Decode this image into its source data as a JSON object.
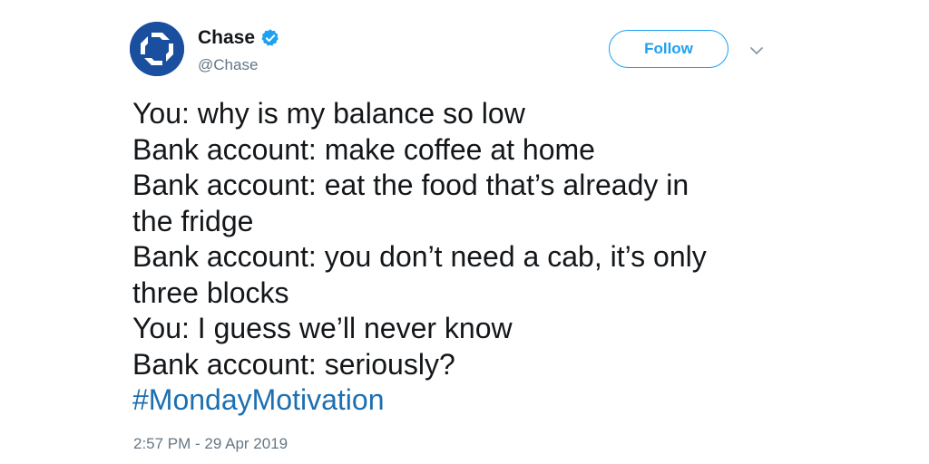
{
  "account": {
    "display_name": "Chase",
    "handle": "@Chase",
    "verified_icon": "verified-badge-icon",
    "avatar_icon": "chase-octagon-logo"
  },
  "header": {
    "follow_label": "Follow",
    "menu_icon": "chevron-down-icon"
  },
  "tweet": {
    "lines": [
      "You: why is my balance so low",
      "Bank account: make coffee at home",
      "Bank account: eat the food that’s already in",
      "the fridge",
      "Bank account: you don’t need a cab, it’s only",
      "three blocks",
      "You: I guess we’ll never know",
      "Bank account: seriously?"
    ],
    "hashtag": "#MondayMotivation",
    "timestamp": "2:57 PM - 29 Apr 2019"
  },
  "colors": {
    "brand_blue": "#1a4fa0",
    "twitter_blue": "#1da1f2",
    "hashtag_blue": "#1b6fb2",
    "secondary_text": "#657786",
    "primary_text": "#14171a"
  }
}
